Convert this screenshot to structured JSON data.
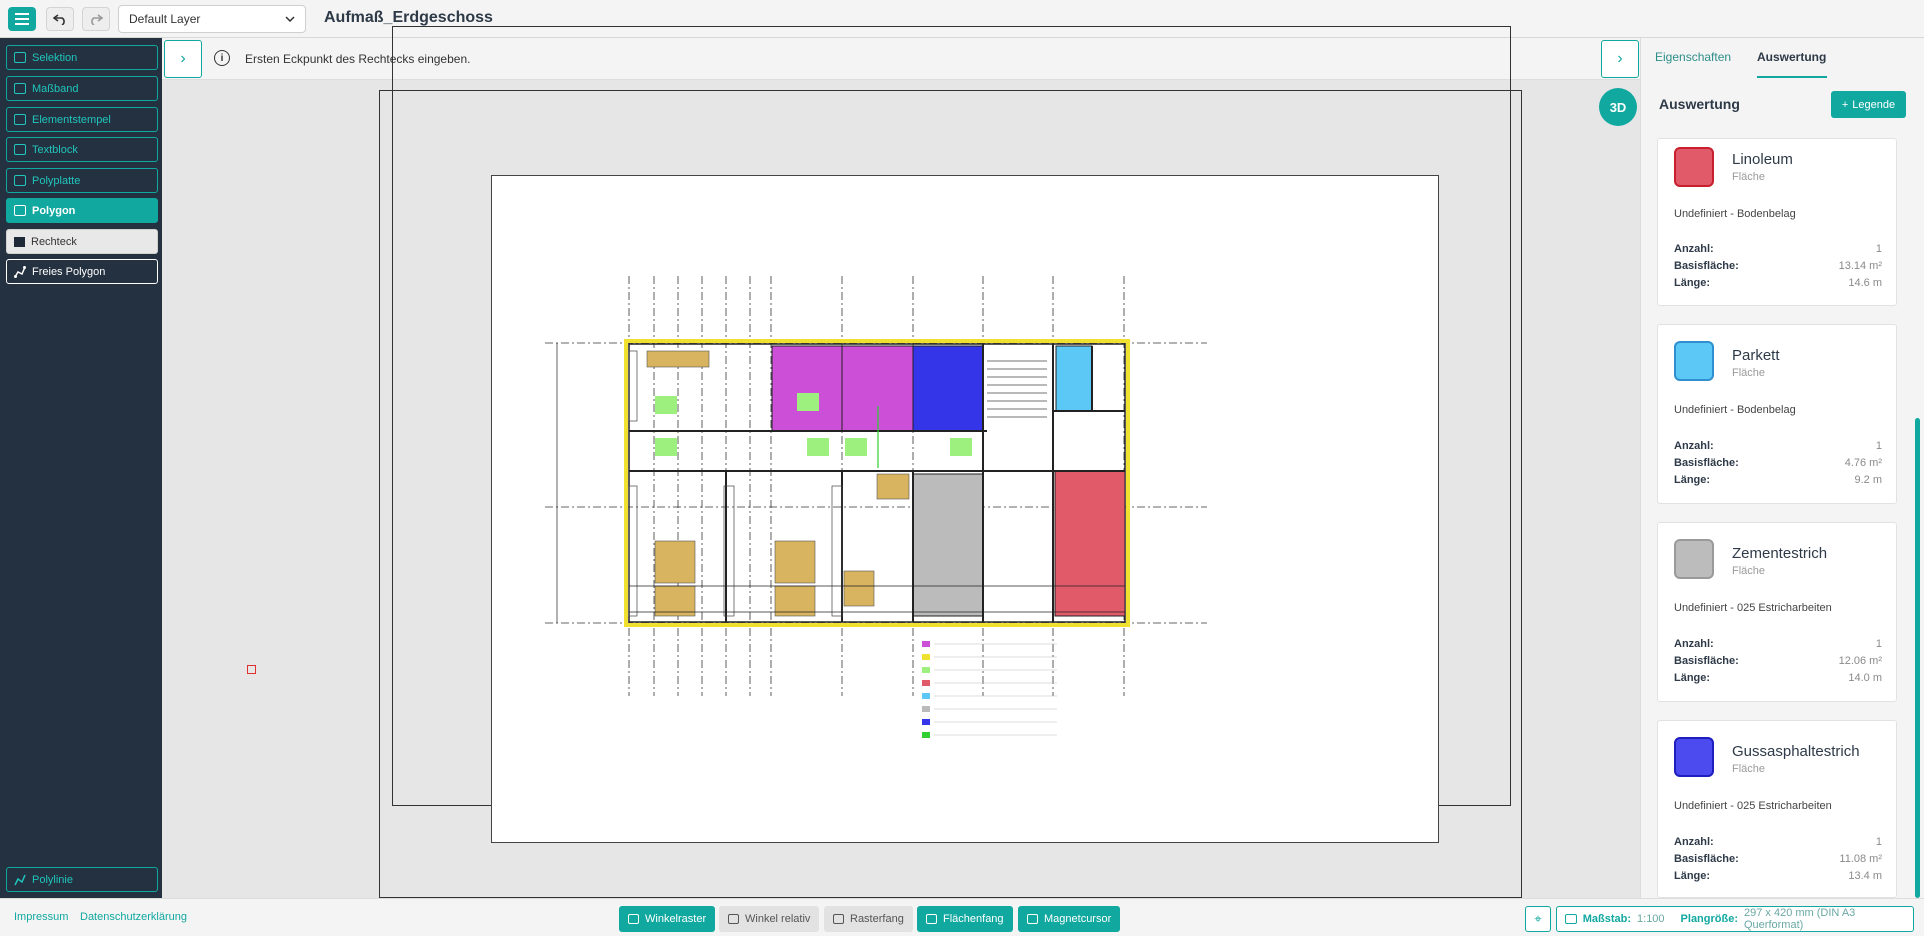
{
  "topbar": {
    "layer_value": "Default Layer",
    "document_title": "Aufmaß_Erdgeschoss"
  },
  "sidebar": {
    "tools": [
      {
        "label": "Selektion"
      },
      {
        "label": "Maßband"
      },
      {
        "label": "Elementstempel"
      },
      {
        "label": "Textblock"
      },
      {
        "label": "Polyplatte"
      },
      {
        "label": "Polygon"
      },
      {
        "label": "Rechteck"
      },
      {
        "label": "Freies Polygon"
      }
    ],
    "bottom_tool": "Polylinie"
  },
  "hint": {
    "text": "Ersten Eckpunkt des Rechtecks eingeben."
  },
  "canvas": {
    "btn_3d": "3D"
  },
  "right_panel": {
    "tabs": [
      "Eigenschaften",
      "Auswertung"
    ],
    "active_tab": "Auswertung",
    "title": "Auswertung",
    "legend_button": "Legende",
    "labels": {
      "count": "Anzahl:",
      "area": "Basisfläche:",
      "length": "Länge:"
    },
    "materials": [
      {
        "name": "Linoleum",
        "type": "Fläche",
        "desc": "Undefiniert - Bodenbelag",
        "count": "1",
        "area": "13.14 m²",
        "length": "14.6 m",
        "color": "#e15a6a",
        "border": "#c8202f"
      },
      {
        "name": "Parkett",
        "type": "Fläche",
        "desc": "Undefiniert - Bodenbelag",
        "count": "1",
        "area": "4.76 m²",
        "length": "9.2 m",
        "color": "#5bc8f5",
        "border": "#2f8fcf"
      },
      {
        "name": "Zementestrich",
        "type": "Fläche",
        "desc": "Undefiniert - 025 Estricharbeiten",
        "count": "1",
        "area": "12.06 m²",
        "length": "14.0 m",
        "color": "#bcbcbc",
        "border": "#9a9a9a"
      },
      {
        "name": "Gussasphaltestrich",
        "type": "Fläche",
        "desc": "Undefiniert - 025 Estricharbeiten",
        "count": "1",
        "area": "11.08 m²",
        "length": "13.4 m",
        "color": "#4b4bf0",
        "border": "#1f1fbf"
      }
    ]
  },
  "bottombar": {
    "links": [
      "Impressum",
      "Datenschutzerklärung"
    ],
    "snaps": [
      {
        "label": "Winkelraster",
        "on": true
      },
      {
        "label": "Winkel relativ",
        "on": false
      },
      {
        "label": "Rasterfang",
        "on": false
      },
      {
        "label": "Flächenfang",
        "on": true
      },
      {
        "label": "Magnetcursor",
        "on": true
      }
    ],
    "scale_label": "Maßstab:",
    "scale_value": "1:100",
    "plansize_label": "Plangröße:",
    "plansize_value": "297 x 420 mm (DIN A3 Querformat)"
  }
}
